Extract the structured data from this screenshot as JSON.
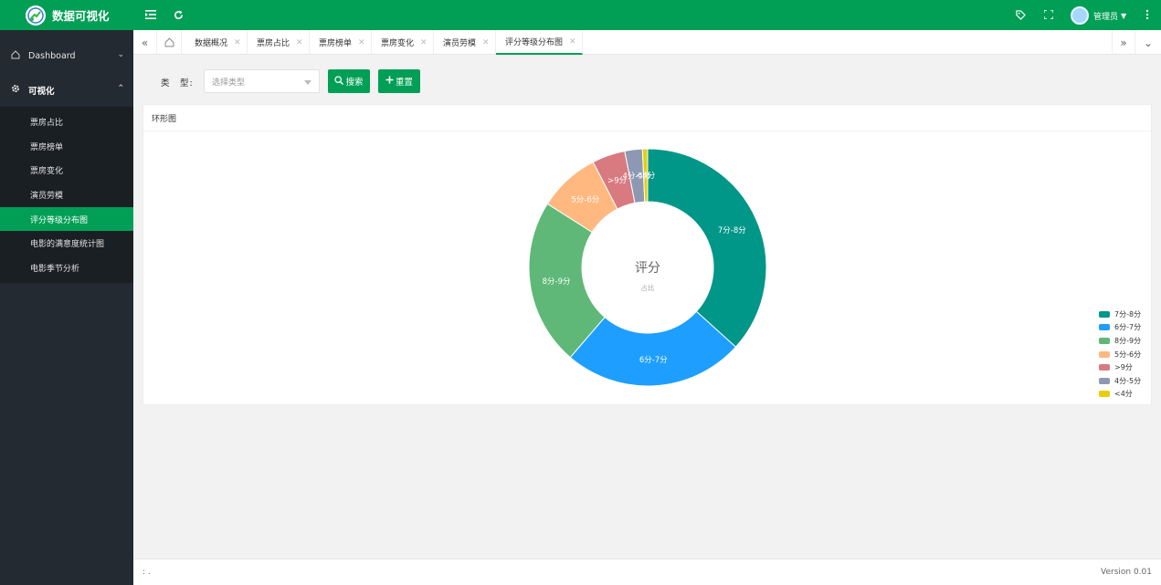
{
  "app": {
    "title": "数据可视化"
  },
  "header": {
    "user_name": "管理员",
    "icons": [
      "menu-fold-icon",
      "refresh-icon",
      "tag-icon",
      "fullscreen-icon",
      "more-vertical-icon"
    ]
  },
  "sidebar": {
    "groups": [
      {
        "label": "Dashboard",
        "icon": "home-icon"
      },
      {
        "label": "可视化",
        "icon": "gear-icon"
      }
    ],
    "items": [
      {
        "label": "票房占比"
      },
      {
        "label": "票房榜单"
      },
      {
        "label": "票房变化"
      },
      {
        "label": "演员劳模"
      },
      {
        "label": "评分等级分布图"
      },
      {
        "label": "电影的满意度统计图"
      },
      {
        "label": "电影季节分析"
      }
    ],
    "active_index": 4
  },
  "tabs": [
    {
      "label": "数据概况"
    },
    {
      "label": "票房占比"
    },
    {
      "label": "票房榜单"
    },
    {
      "label": "票房变化"
    },
    {
      "label": "演员劳模"
    },
    {
      "label": "评分等级分布图"
    }
  ],
  "filter": {
    "label": "类　型:",
    "select_placeholder": "选择类型",
    "search_label": "搜索",
    "reset_label": "重置"
  },
  "card": {
    "title": "环形图"
  },
  "chart_data": {
    "type": "pie",
    "donut": true,
    "center_title": "评分",
    "center_subtitle": "占比",
    "categories": [
      "7分-8分",
      "6分-7分",
      "8分-9分",
      "5分-6分",
      ">9分",
      "4分-5分",
      "<4分"
    ],
    "values": [
      36.7,
      24.6,
      22.7,
      8.4,
      4.5,
      2.4,
      0.7
    ],
    "colors": [
      "#009688",
      "#1e9fff",
      "#5fb878",
      "#ffb980",
      "#d87a80",
      "#8d98b3",
      "#e5cf0d"
    ],
    "legend_position": "bottom-right"
  },
  "footer": {
    "left_text": ": .",
    "version": "Version 0.01"
  }
}
